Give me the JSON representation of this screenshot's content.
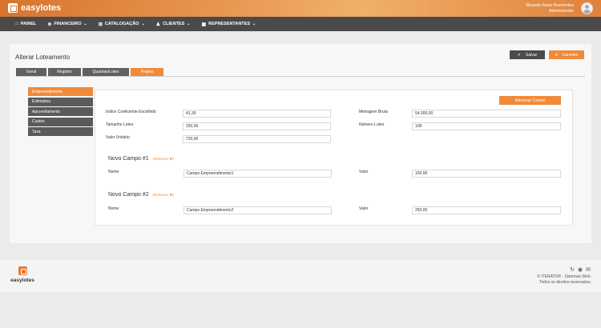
{
  "app": {
    "name": "easylotes",
    "user_name": "Ricardo Aular Barrientos",
    "user_role": "Administrador"
  },
  "nav": [
    {
      "label": "PAINEL",
      "icon": "home-icon",
      "glyph": "⌂",
      "has_dropdown": false
    },
    {
      "label": "FINANCEIRO",
      "icon": "money-icon",
      "glyph": "⊜",
      "has_dropdown": true
    },
    {
      "label": "CATALOGAÇÃO",
      "icon": "book-icon",
      "glyph": "⊞",
      "has_dropdown": true
    },
    {
      "label": "CLIENTES",
      "icon": "users-icon",
      "glyph": "♟",
      "has_dropdown": true
    },
    {
      "label": "REPRESENTANTES",
      "icon": "briefcase-icon",
      "glyph": "▣",
      "has_dropdown": true
    }
  ],
  "page": {
    "title": "Alterar Loteamento",
    "save_label": "Salvar",
    "cancel_label": "Cancelar"
  },
  "tabs": [
    {
      "label": "Geral",
      "active": false
    },
    {
      "label": "Registro",
      "active": false
    },
    {
      "label": "Quadras/Lotes",
      "active": false
    },
    {
      "label": "Projeto",
      "active": true
    }
  ],
  "side_menu": [
    {
      "label": "Empreendimento",
      "active": true
    },
    {
      "label": "Estimativa",
      "active": false
    },
    {
      "label": "Aproveitamento",
      "active": false
    },
    {
      "label": "Custos",
      "active": false
    },
    {
      "label": "Taxa",
      "active": false
    }
  ],
  "form": {
    "add_fields_label": "Adicionar Campo",
    "indice_label": "Índice Coeficiente Escolhido",
    "indice_value": "41,30",
    "tamanho_label": "Tamanho Lotes",
    "tamanho_value": "250,00",
    "valor_unitario_label": "Valor Unitário",
    "valor_unitario_value": "720,00",
    "metragem_label": "Metragem Bruta",
    "metragem_value": "54.000,00",
    "numero_lotes_label": "Número Lotes",
    "numero_lotes_value": "108"
  },
  "custom_fields": [
    {
      "title": "Novo Campo #1",
      "remove_label": "(Remover ✖)",
      "name_label": "Nome",
      "name_value": "Campo Empreendimento1",
      "value_label": "Valor",
      "value_value": "150,00"
    },
    {
      "title": "Novo Campo #2",
      "remove_label": "(Remover ✖)",
      "name_label": "Nome",
      "name_value": "Campo Empreendimento2",
      "value_label": "Valor",
      "value_value": "250,00"
    }
  ],
  "footer": {
    "logo_text": "easylotes",
    "copyright": "© ITERATOR - Sistemas Web.",
    "rights": "Todos os direitos reservados.",
    "icons": [
      "refresh-icon",
      "github-icon",
      "mail-icon"
    ]
  },
  "colors": {
    "accent": "#ef8a3a",
    "dark": "#4a4a4a"
  }
}
